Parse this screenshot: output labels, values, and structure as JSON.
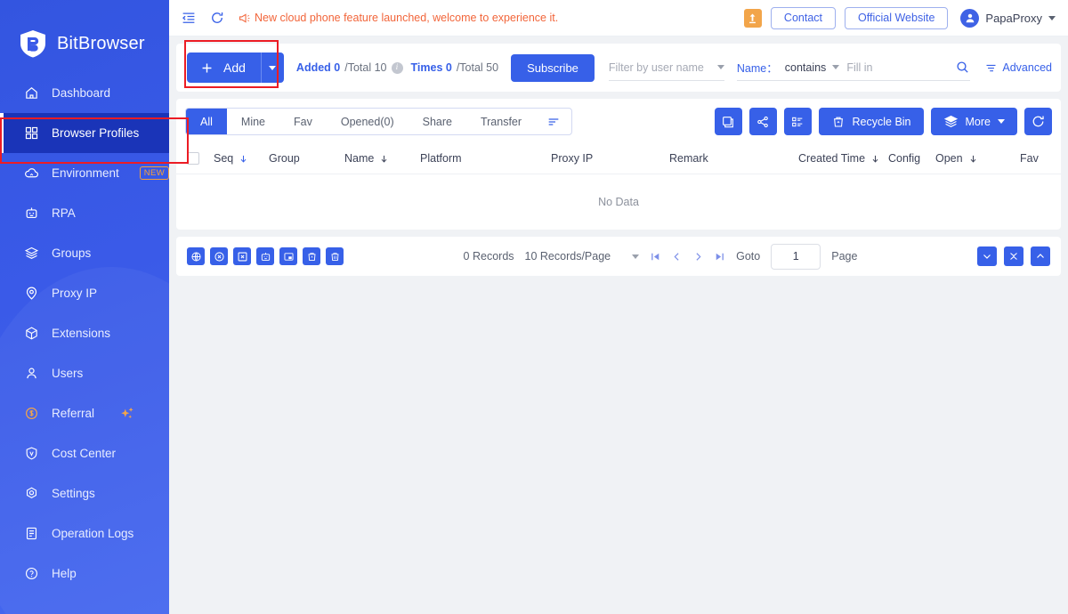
{
  "brand": {
    "name": "BitBrowser",
    "logo_icon": "bitbrowser-shield-logo"
  },
  "colors": {
    "primary": "#3760e8",
    "sidebar": "#3a5ae8",
    "sidebar_active": "#1a34b8",
    "accent_orange": "#f2a54a",
    "notice": "#f2653a",
    "highlight": "#ec1c24"
  },
  "sidebar": {
    "items": [
      {
        "label": "Dashboard",
        "icon": "home-icon",
        "active": false
      },
      {
        "label": "Browser Profiles",
        "icon": "grid-squares-icon",
        "active": true
      },
      {
        "label": "Environment",
        "icon": "cloud-icon",
        "active": false,
        "badge": "NEW"
      },
      {
        "label": "RPA",
        "icon": "robot-icon",
        "active": false
      },
      {
        "label": "Groups",
        "icon": "layers-icon",
        "active": false
      },
      {
        "label": "Proxy IP",
        "icon": "location-pin-icon",
        "active": false
      },
      {
        "label": "Extensions",
        "icon": "puzzle-box-icon",
        "active": false
      },
      {
        "label": "Users",
        "icon": "user-icon",
        "active": false
      },
      {
        "label": "Referral",
        "icon": "coin-dollar-icon",
        "active": false,
        "sparkle": true
      },
      {
        "label": "Cost Center",
        "icon": "shield-v-icon",
        "active": false
      },
      {
        "label": "Settings",
        "icon": "gear-icon",
        "active": false
      },
      {
        "label": "Operation Logs",
        "icon": "document-list-icon",
        "active": false
      },
      {
        "label": "Help",
        "icon": "question-circle-icon",
        "active": false
      }
    ]
  },
  "topbar": {
    "collapse_icon": "collapse-sidebar-icon",
    "refresh_icon": "refresh-icon",
    "megaphone_icon": "megaphone-icon",
    "notice": "New cloud phone feature launched, welcome to experience it.",
    "alert_icon": "upload-alert-icon",
    "contact_label": "Contact",
    "official_website_label": "Official Website",
    "avatar_icon": "user-avatar-icon",
    "user_name": "PapaProxy",
    "user_caret_icon": "chevron-down-icon"
  },
  "toolbar": {
    "add_label": "Add",
    "add_plus_icon": "plus-icon",
    "add_dropdown_icon": "caret-down-icon",
    "stats": {
      "added_key": "Added 0",
      "added_total": "/Total 10",
      "info_icon": "info-icon",
      "times_key": "Times 0",
      "times_total": "/Total 50"
    },
    "subscribe_label": "Subscribe",
    "user_filter_placeholder": "Filter by user name",
    "name_label": "Name：",
    "operator_value": "contains",
    "fill_placeholder": "Fill in",
    "fill_value": "",
    "search_icon": "search-icon",
    "advanced_label": "Advanced",
    "advanced_icon": "filter-lines-icon"
  },
  "tabs": {
    "items": [
      {
        "label": "All",
        "active": true
      },
      {
        "label": "Mine",
        "active": false
      },
      {
        "label": "Fav",
        "active": false
      },
      {
        "label": "Opened(0)",
        "active": false
      },
      {
        "label": "Share",
        "active": false
      },
      {
        "label": "Transfer",
        "active": false
      }
    ],
    "sort_icon": "sort-lines-icon"
  },
  "tab_actions": {
    "buttons": [
      {
        "name": "columns-settings-button",
        "icon": "window-columns-icon"
      },
      {
        "name": "share-button",
        "icon": "share-nodes-icon"
      },
      {
        "name": "list-view-button",
        "icon": "list-detail-icon"
      }
    ],
    "recycle_bin_label": "Recycle Bin",
    "recycle_bin_icon": "trash-bin-icon",
    "more_label": "More",
    "more_icon": "layers-stack-icon",
    "more_caret_icon": "caret-down-icon",
    "refresh_icon": "refresh-circle-icon"
  },
  "table": {
    "select_all_checkbox": false,
    "columns": [
      {
        "label": "Seq",
        "sortable": true
      },
      {
        "label": "Group",
        "sortable": false
      },
      {
        "label": "Name",
        "sortable": true
      },
      {
        "label": "Platform",
        "sortable": false
      },
      {
        "label": "Proxy IP",
        "sortable": false
      },
      {
        "label": "Remark",
        "sortable": false
      },
      {
        "label": "Created Time",
        "sortable": true
      },
      {
        "label": "Config",
        "sortable": false
      },
      {
        "label": "Open",
        "sortable": true
      },
      {
        "label": "Fav",
        "sortable": false
      }
    ],
    "rows": [],
    "empty_text": "No Data"
  },
  "footer": {
    "mini_buttons": [
      {
        "name": "browser-open-all-button",
        "icon": "globe-grid-icon"
      },
      {
        "name": "close-all-button",
        "icon": "circle-x-icon"
      },
      {
        "name": "close-selected-button",
        "icon": "square-x-icon"
      },
      {
        "name": "rpa-run-button",
        "icon": "robot-box-icon"
      },
      {
        "name": "window-arrange-button",
        "icon": "window-layout-icon"
      },
      {
        "name": "clear-cache-button",
        "icon": "trash-arrow-icon"
      },
      {
        "name": "delete-button",
        "icon": "trash-icon"
      }
    ],
    "records_text": "0 Records",
    "page_size_label": "10 Records/Page",
    "page_size_caret_icon": "caret-down-icon",
    "first_page_icon": "first-page-icon",
    "prev_page_icon": "chevron-left-icon",
    "next_page_icon": "chevron-right-icon",
    "last_page_icon": "last-page-icon",
    "goto_label": "Goto",
    "goto_value": "1",
    "page_label": "Page",
    "corner_buttons": [
      {
        "name": "scroll-down-button",
        "icon": "chevron-down-icon"
      },
      {
        "name": "collapse-button",
        "icon": "collapse-arrows-icon"
      },
      {
        "name": "scroll-up-button",
        "icon": "chevron-up-icon"
      }
    ]
  }
}
